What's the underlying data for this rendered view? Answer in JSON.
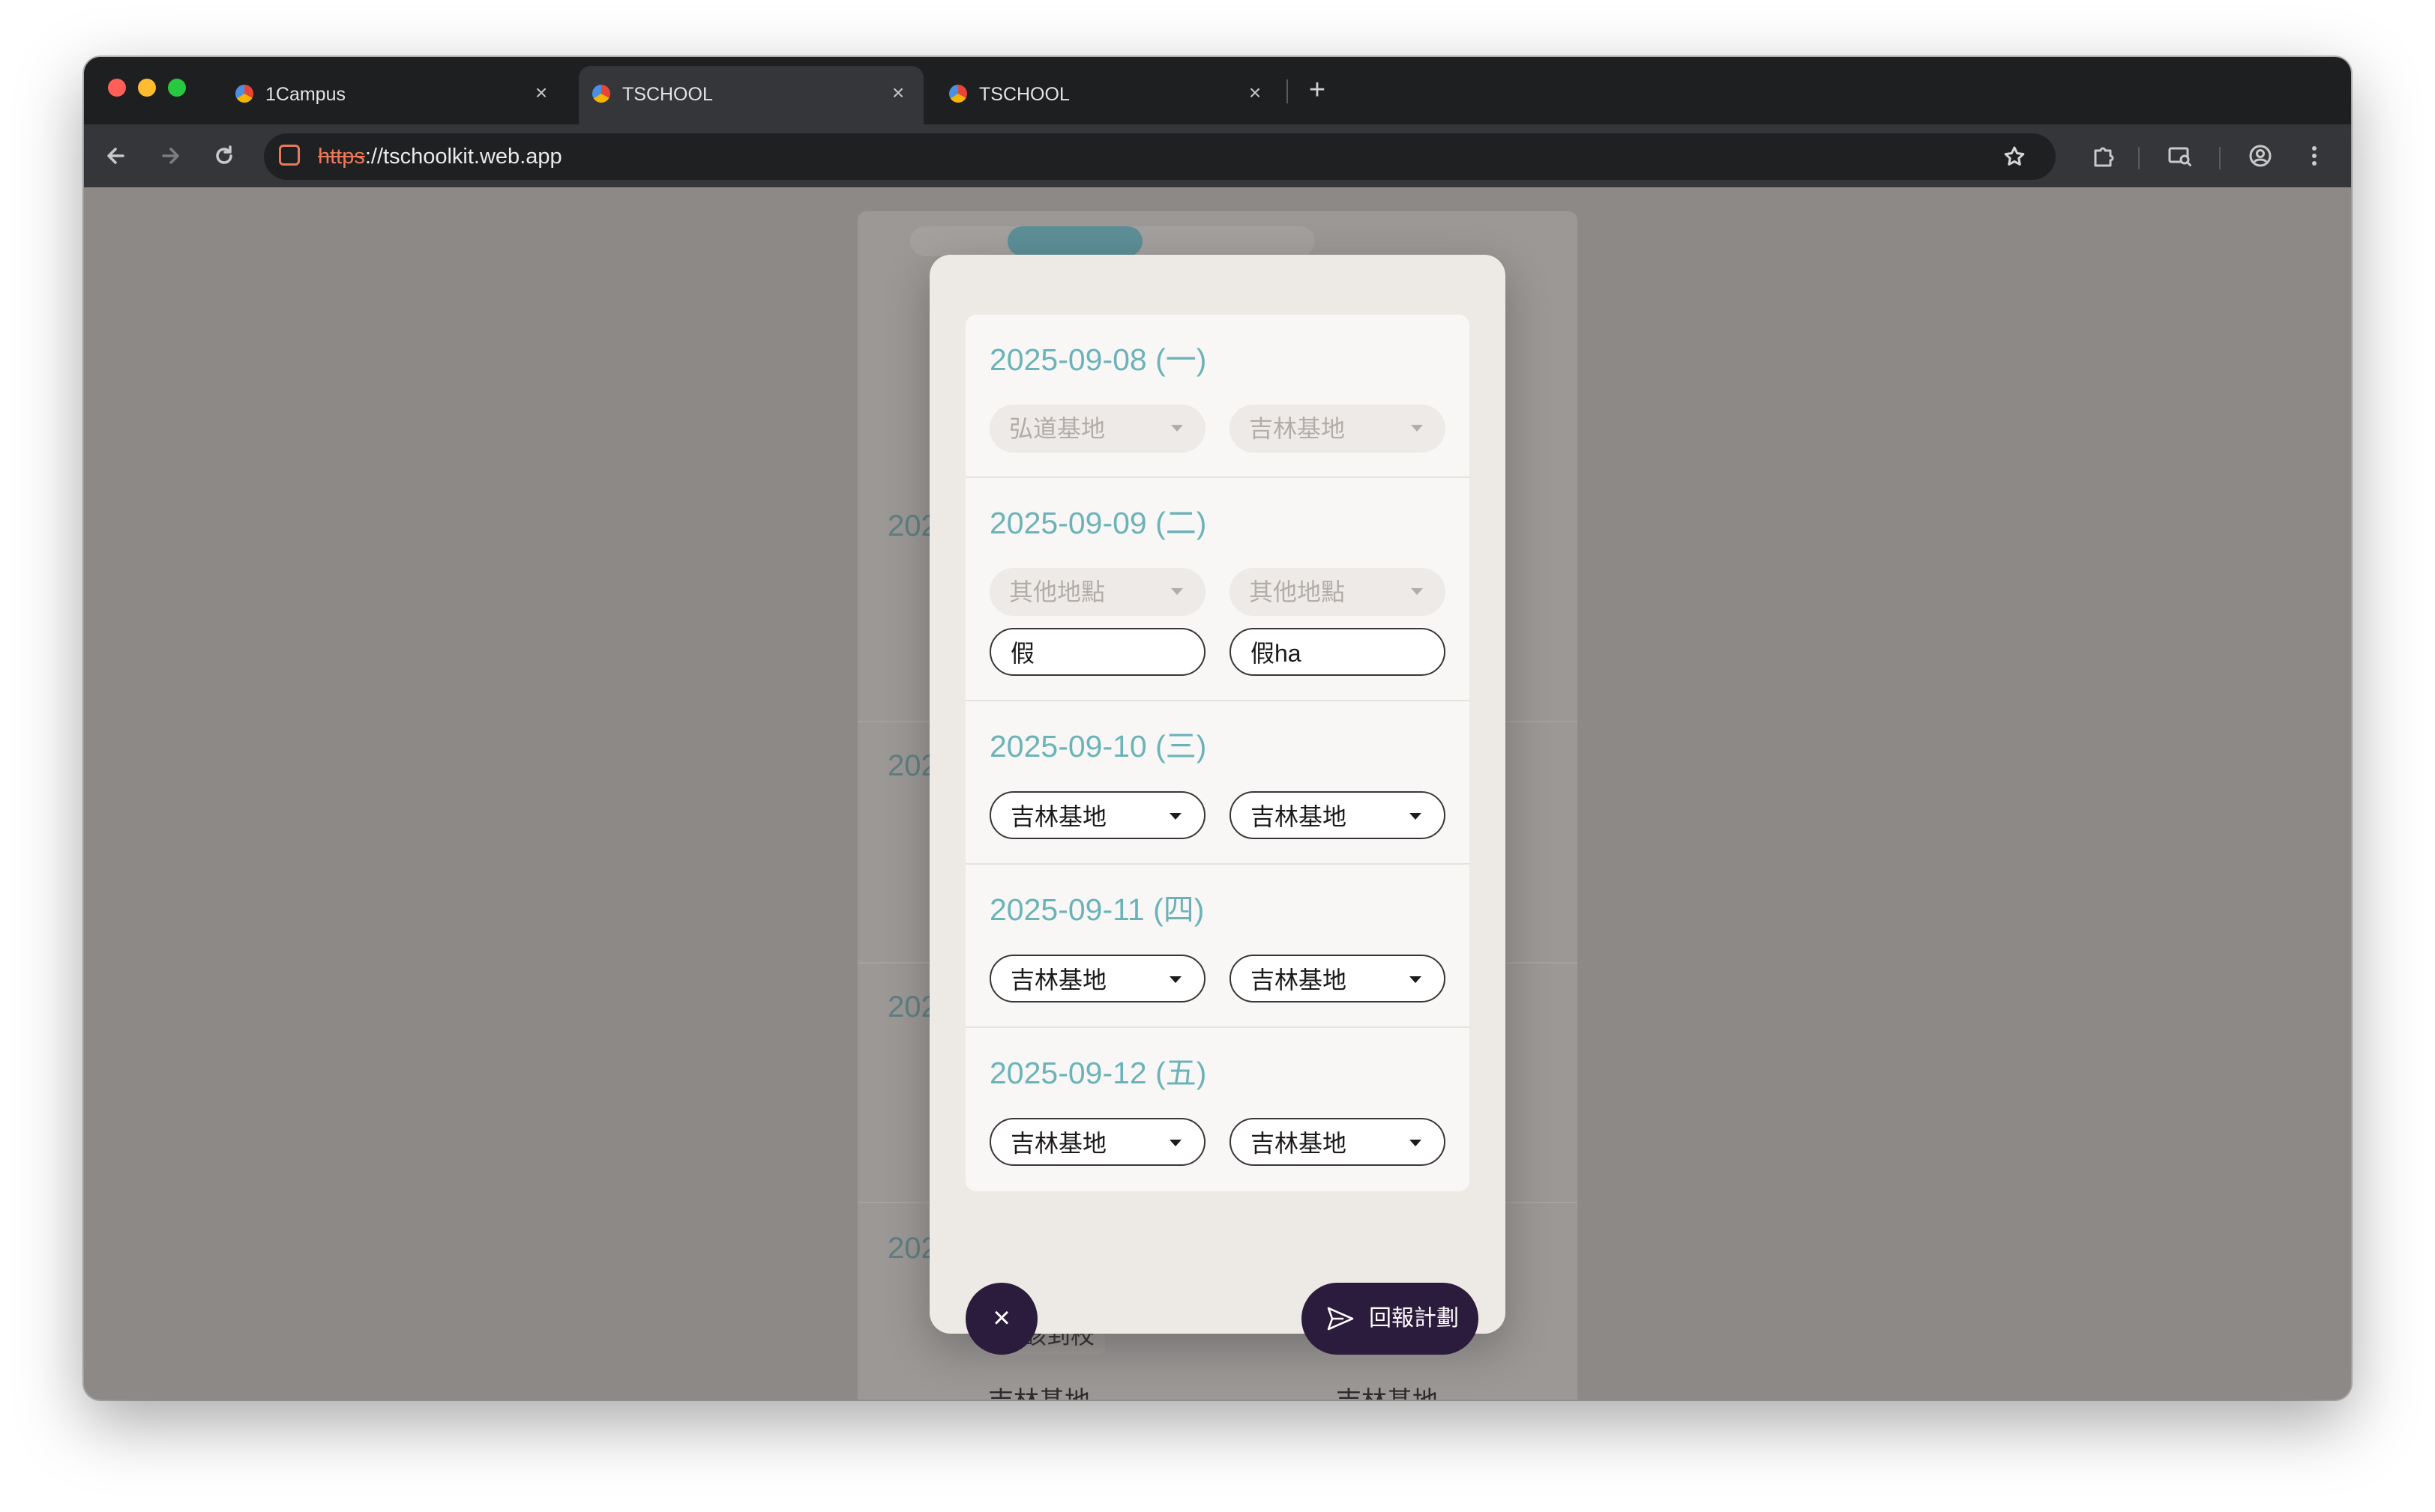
{
  "browser": {
    "tabs": [
      {
        "title": "1Campus",
        "active": false
      },
      {
        "title": "TSCHOOL",
        "active": true
      },
      {
        "title": "TSCHOOL",
        "active": false
      }
    ],
    "new_tab_symbol": "+",
    "close_symbol": "×",
    "url_scheme": "https",
    "url_rest": "://tschoolkit.web.app",
    "traffic_lights": {
      "close": "#ff5f57",
      "minimize": "#febc2e",
      "zoom": "#28c840"
    }
  },
  "background": {
    "year_prefix": "202",
    "chip_label": "應該到校",
    "location_label": "吉林基地"
  },
  "modal": {
    "days": [
      {
        "date": "2025-09-08 (一)",
        "am": "弘道基地",
        "pm": "吉林基地",
        "disabled": true
      },
      {
        "date": "2025-09-09 (二)",
        "am": "其他地點",
        "pm": "其他地點",
        "disabled": true,
        "am_note": "假",
        "pm_note": "假ha"
      },
      {
        "date": "2025-09-10 (三)",
        "am": "吉林基地",
        "pm": "吉林基地",
        "disabled": false
      },
      {
        "date": "2025-09-11 (四)",
        "am": "吉林基地",
        "pm": "吉林基地",
        "disabled": false
      },
      {
        "date": "2025-09-12 (五)",
        "am": "吉林基地",
        "pm": "吉林基地",
        "disabled": false
      }
    ],
    "close_label": "×",
    "submit_label": "回報計劃"
  },
  "icons": {
    "back": "arrow-left-icon",
    "forward": "arrow-right-icon",
    "reload": "reload-icon",
    "bookmark": "star-icon",
    "extensions": "puzzle-icon",
    "cast": "cast-search-icon",
    "profile": "profile-icon",
    "menu": "kebab-menu-icon",
    "submit": "send-icon"
  },
  "colors": {
    "accent_teal": "#6cb3b9",
    "button_dark": "#2b1b3d"
  }
}
